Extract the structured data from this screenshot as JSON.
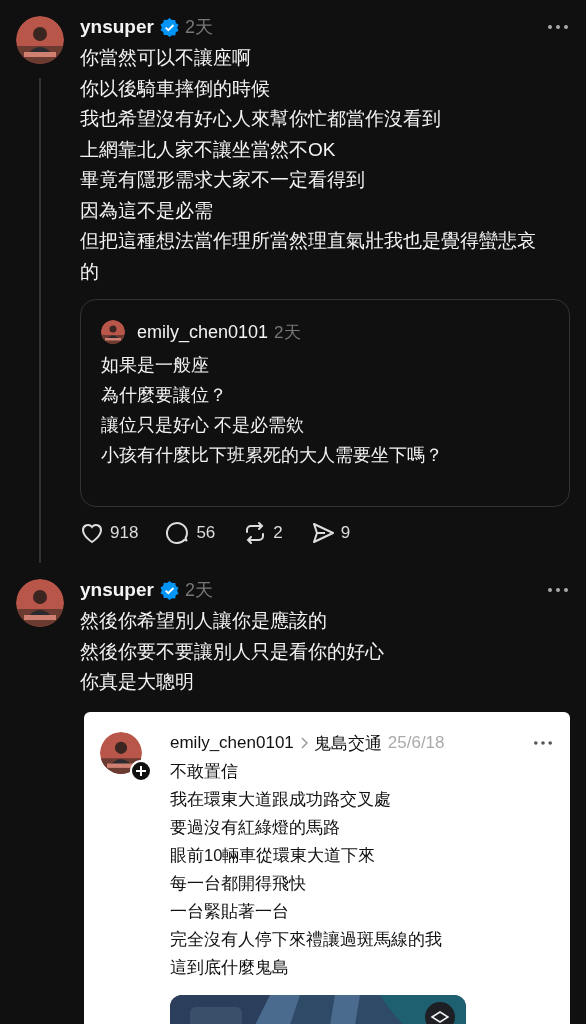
{
  "posts": [
    {
      "username": "ynsuper",
      "verified": true,
      "time": "2天",
      "thread_line": true,
      "lines": [
        "你當然可以不讓座啊",
        "你以後騎車摔倒的時候",
        "我也希望沒有好心人來幫你忙都當作沒看到",
        "上網靠北人家不讓坐當然不OK",
        "畢竟有隱形需求大家不一定看得到",
        "因為這不是必需",
        "但把這種想法當作理所當然理直氣壯我也是覺得蠻悲哀的"
      ],
      "quote": {
        "username": "emily_chen0101",
        "time": "2天",
        "lines": [
          "如果是一般座",
          "為什麼要讓位？",
          "讓位只是好心 不是必需欸",
          "小孩有什麼比下班累死的大人需要坐下嗎？"
        ]
      },
      "actions": [
        {
          "kind": "like",
          "count": "918"
        },
        {
          "kind": "reply",
          "count": "56"
        },
        {
          "kind": "repost",
          "count": "2"
        },
        {
          "kind": "share",
          "count": "9"
        }
      ]
    },
    {
      "username": "ynsuper",
      "verified": true,
      "time": "2天",
      "thread_line": false,
      "lines": [
        "然後你希望別人讓你是應該的",
        "然後你要不要讓別人只是看你的好心",
        "你真是大聰明"
      ],
      "screenshot": {
        "username": "emily_chen0101",
        "community": "鬼島交通",
        "date": "25/6/18",
        "lines": [
          "不敢置信",
          "我在環東大道跟成功路交叉處",
          "要過沒有紅綠燈的馬路",
          "眼前10輛車從環東大道下來",
          "每一台都開得飛快",
          "一台緊貼著一台",
          "完全沒有人停下來禮讓過斑馬線的我",
          "這到底什麼鬼島"
        ]
      }
    }
  ]
}
